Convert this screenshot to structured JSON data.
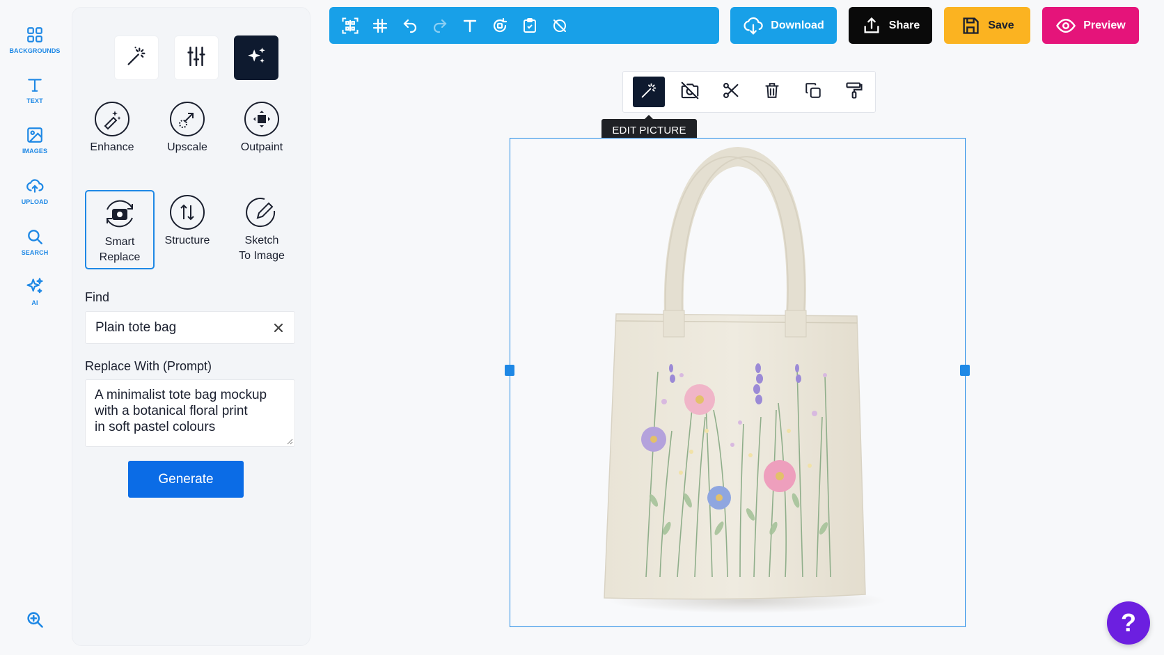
{
  "rail": {
    "items": [
      {
        "label": "BACKGROUNDS",
        "icon": "grid-icon"
      },
      {
        "label": "TEXT",
        "icon": "text-icon"
      },
      {
        "label": "IMAGES",
        "icon": "image-icon"
      },
      {
        "label": "UPLOAD",
        "icon": "cloud-upload-icon"
      },
      {
        "label": "SEARCH",
        "icon": "search-icon"
      },
      {
        "label": "AI",
        "icon": "sparkles-icon"
      }
    ],
    "zoom_icon": "zoom-in-icon"
  },
  "panel": {
    "modes": [
      {
        "icon": "magic-wand-icon",
        "active": false
      },
      {
        "icon": "sliders-icon",
        "active": false
      },
      {
        "icon": "sparkles-icon",
        "active": true
      }
    ],
    "tools": [
      {
        "label": "Enhance",
        "icon": "enhance-icon"
      },
      {
        "label": "Upscale",
        "icon": "upscale-icon"
      },
      {
        "label": "Outpaint",
        "icon": "outpaint-icon"
      },
      {
        "label": "Smart\nReplace",
        "icon": "smart-replace-icon",
        "selected": true
      },
      {
        "label": "Structure",
        "icon": "structure-icon"
      },
      {
        "label": "Sketch\nTo Image",
        "icon": "sketch-icon"
      }
    ],
    "find_label": "Find",
    "find_value": "Plain tote bag",
    "replace_label": "Replace With (Prompt)",
    "replace_value": "A minimalist tote bag mockup\nwith a botanical floral print\nin soft pastel colours",
    "generate_label": "Generate"
  },
  "toolbar": {
    "icons": [
      "qr-code-icon",
      "grid-hash-icon",
      "undo-icon",
      "redo-icon",
      "text-icon",
      "rotate-icon",
      "clipboard-icon",
      "no-shadow-icon"
    ]
  },
  "actions": {
    "download": "Download",
    "share": "Share",
    "save": "Save",
    "preview": "Preview"
  },
  "context_bar": {
    "icons": [
      "magic-wand-icon",
      "camera-off-icon",
      "scissors-icon",
      "trash-icon",
      "duplicate-icon",
      "paint-roller-icon"
    ],
    "tooltip": "EDIT PICTURE"
  },
  "help_label": "?",
  "colors": {
    "accent": "#18a0e8",
    "primary_button": "#0b6ce6",
    "share": "#0a0a0a",
    "save": "#fbb321",
    "preview": "#e5147a",
    "help": "#6c1fe0",
    "dark_active": "#0e1a2f"
  }
}
